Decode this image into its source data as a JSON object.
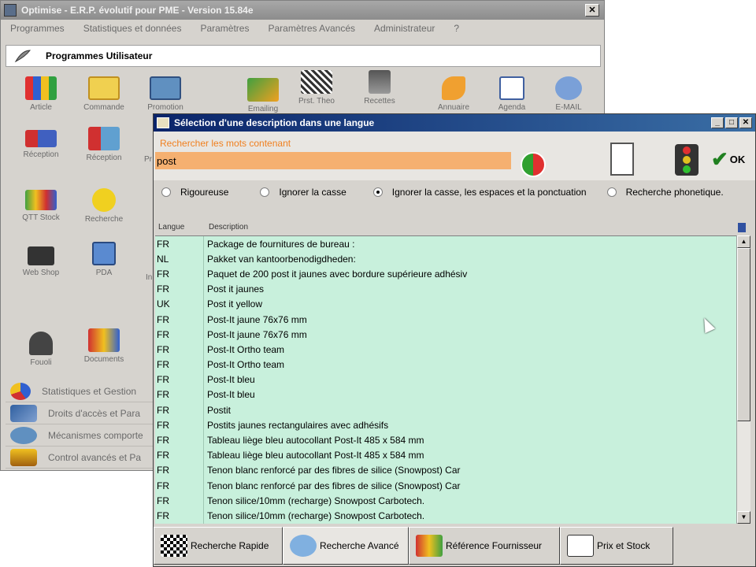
{
  "main_window": {
    "title": "Optimise  -  E.R.P. évolutif pour PME  -  Version 15.84e",
    "menu": [
      "Programmes",
      "Statistiques et données",
      "Paramètres",
      "Paramètres Avancés",
      "Administrateur",
      "?"
    ],
    "section_title": "Programmes Utilisateur",
    "launchers": {
      "article": "Article",
      "commande": "Commande",
      "promotion": "Promotion",
      "emailing": "Emailing",
      "prst_theo": "Prst. Theo",
      "recettes": "Recettes",
      "annuaire": "Annuaire",
      "agenda": "Agenda",
      "email": "E-MAIL",
      "reception_1": "Réception",
      "reception_2": "Réception",
      "partial_pr": "Pr",
      "qtt_stock": "QTT Stock",
      "recherche": "Recherche",
      "web_shop": "Web Shop",
      "pda": "PDA",
      "partial_in": "In",
      "fouoli": "Fouoli",
      "documents": "Documents"
    },
    "side_items": [
      "Statistiques et Gestion",
      "Droits d'accès et Para",
      "Mécanismes comporte",
      "Control avancés et Pa"
    ]
  },
  "dialog": {
    "title": "Sélection d'une description dans une langue",
    "search_label": "Rechercher les mots contenant",
    "search_value": "post",
    "ok_label": "OK",
    "radio_options": [
      {
        "label": "Rigoureuse",
        "selected": false
      },
      {
        "label": "Ignorer la casse",
        "selected": false
      },
      {
        "label": "Ignorer la casse, les espaces et  la ponctuation",
        "selected": true
      },
      {
        "label": "Recherche phonetique.",
        "selected": false
      }
    ],
    "columns": {
      "lang": "Langue",
      "desc": "Description"
    },
    "rows": [
      {
        "lang": "FR",
        "desc": "Package de fournitures de bureau :"
      },
      {
        "lang": "NL",
        "desc": "Pakket van kantoorbenodigdheden:"
      },
      {
        "lang": "FR",
        "desc": "Paquet de 200 post it jaunes avec bordure supérieure adhésiv"
      },
      {
        "lang": "FR",
        "desc": "Post it jaunes"
      },
      {
        "lang": "UK",
        "desc": "Post it yellow"
      },
      {
        "lang": "FR",
        "desc": "Post-It  jaune 76x76 mm"
      },
      {
        "lang": "FR",
        "desc": "Post-It  jaune 76x76 mm"
      },
      {
        "lang": "FR",
        "desc": "Post-It Ortho team"
      },
      {
        "lang": "FR",
        "desc": "Post-It Ortho team"
      },
      {
        "lang": "FR",
        "desc": "Post-It bleu"
      },
      {
        "lang": "FR",
        "desc": "Post-It bleu"
      },
      {
        "lang": "FR",
        "desc": "Postit"
      },
      {
        "lang": "FR",
        "desc": "Postits jaunes rectangulaires avec adhésifs"
      },
      {
        "lang": "FR",
        "desc": "Tableau liège bleu autocollant Post-It 485 x 584 mm"
      },
      {
        "lang": "FR",
        "desc": "Tableau liège bleu autocollant Post-It 485 x 584 mm"
      },
      {
        "lang": "FR",
        "desc": "Tenon blanc renforcé par des fibres de silice (Snowpost) Car"
      },
      {
        "lang": "FR",
        "desc": "Tenon blanc renforcé par des fibres de silice (Snowpost) Car"
      },
      {
        "lang": "FR",
        "desc": "Tenon silice/10mm (recharge) Snowpost Carbotech."
      },
      {
        "lang": "FR",
        "desc": "Tenon silice/10mm (recharge) Snowpost Carbotech."
      }
    ],
    "bottom_tabs": [
      {
        "label": "Recherche Rapide",
        "icon": "checkered-flag-icon"
      },
      {
        "label": "Recherche Avancé",
        "icon": "magnifier-icon"
      },
      {
        "label": "Référence Fournisseur",
        "icon": "supplier-icon"
      },
      {
        "label": "Prix et  Stock",
        "icon": "price-tag-icon"
      }
    ]
  },
  "colors": {
    "grid_bg": "#c8f0dc",
    "search_bg": "#f5b070",
    "search_label": "#f08020",
    "dialog_title_bg": "#0a246a"
  }
}
